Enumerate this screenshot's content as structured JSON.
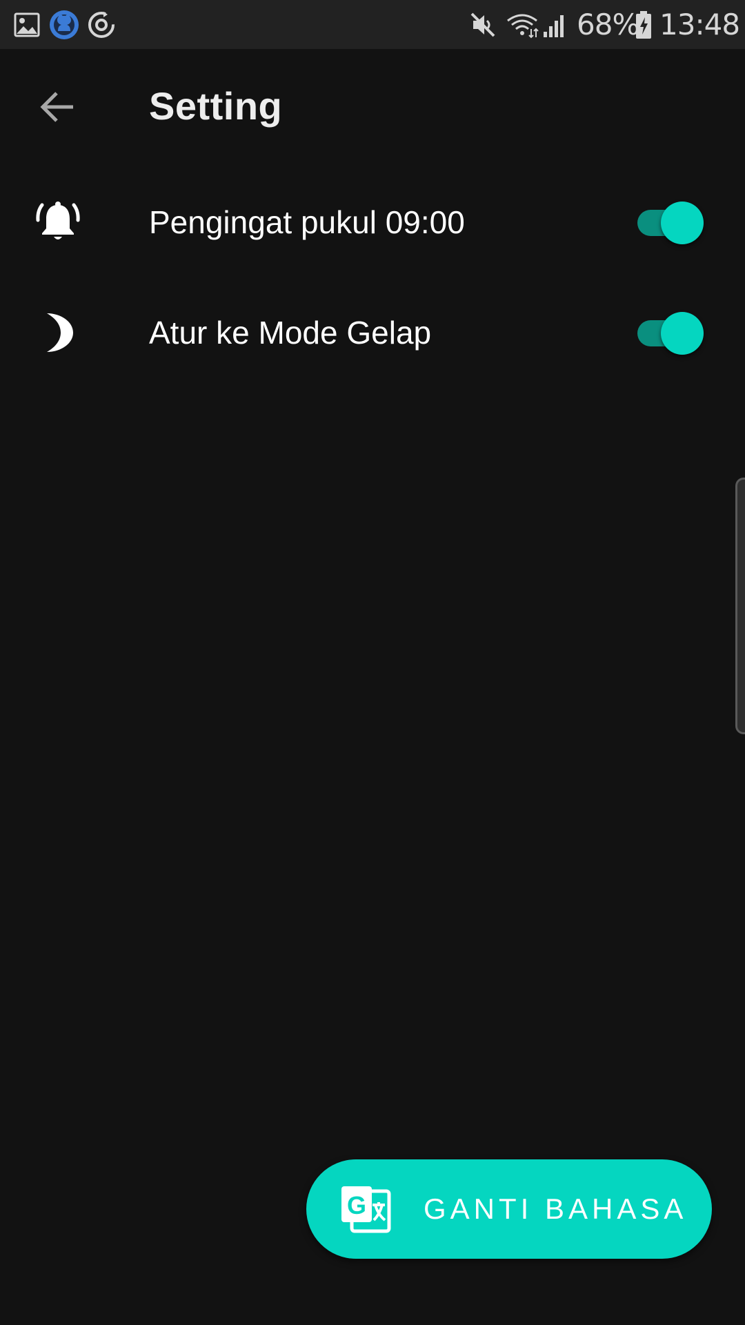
{
  "status_bar": {
    "battery_percent": "68%",
    "time": "13:48",
    "left_icons": [
      "gallery-icon",
      "github-icon",
      "sync-icon"
    ],
    "right_icons": [
      "mute-icon",
      "wifi-icon",
      "signal-icon",
      "battery-charging-icon"
    ]
  },
  "toolbar": {
    "title": "Setting",
    "back_icon": "arrow-back-icon"
  },
  "settings": {
    "items": [
      {
        "icon": "alarm-bell-icon",
        "label": "Pengingat pukul 09:00",
        "enabled": true
      },
      {
        "icon": "moon-icon",
        "label": "Atur ke Mode Gelap",
        "enabled": true
      }
    ]
  },
  "fab": {
    "icon": "translate-icon",
    "label": "GANTI BAHASA"
  },
  "colors": {
    "background": "#121212",
    "accent": "#05d6c0",
    "accent_track": "#0a8f7f",
    "status_bar": "#222222"
  }
}
